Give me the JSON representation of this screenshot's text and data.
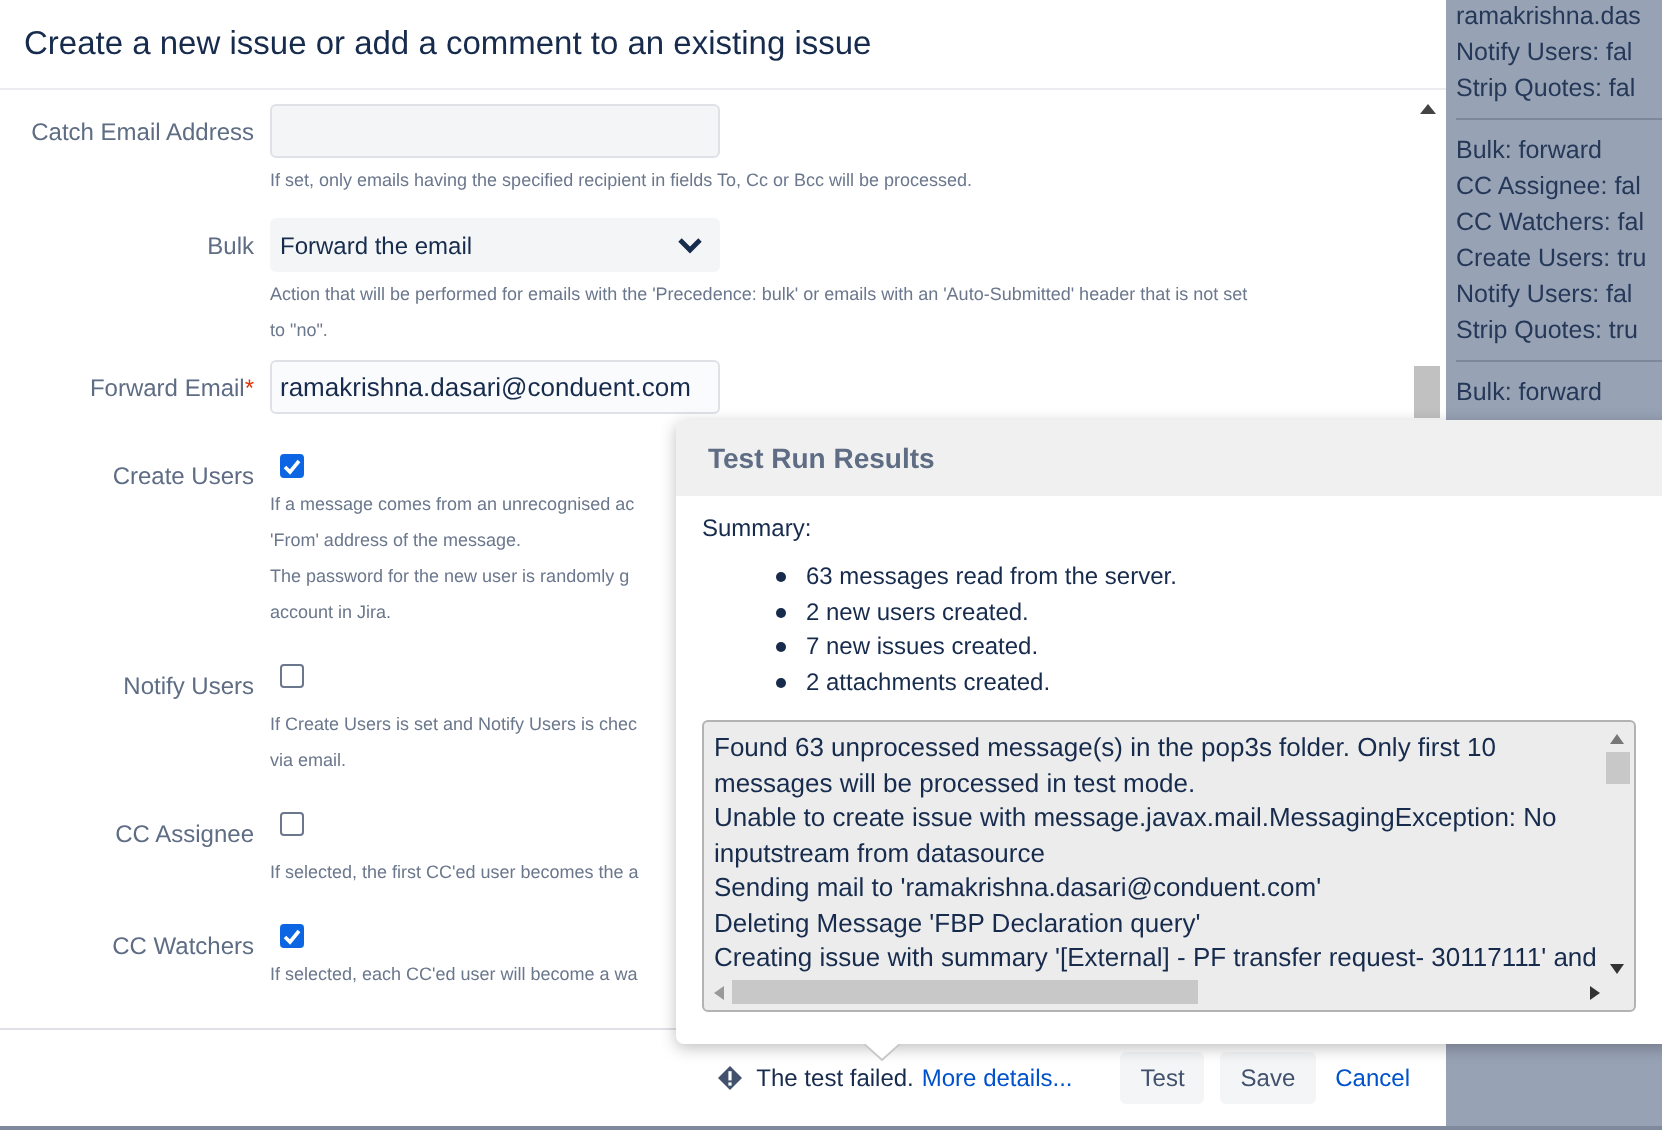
{
  "dialog": {
    "title": "Create a new issue or add a comment to an existing issue",
    "fields": [
      {
        "kind": "text",
        "label": "Catch Email Address",
        "help": [
          "If set, only emails having the specified recipient in fields To, Cc or Bcc will be processed."
        ]
      },
      {
        "kind": "select",
        "label": "Bulk",
        "value": "Forward the email",
        "help": [
          "Action that will be performed for emails with the 'Precedence: bulk' or emails with an 'Auto-Submitted' header that is not set",
          "to \"no\"."
        ]
      },
      {
        "kind": "text",
        "label": "Forward Email",
        "required_mark": "*",
        "value": "ramakrishna.dasari@conduent.com"
      },
      {
        "kind": "checkbox",
        "label": "Create Users",
        "checked": true,
        "help": [
          "If a message comes from an unrecognised ac",
          "'From' address of the message.",
          "The password for the new user is randomly g",
          "account in Jira."
        ]
      },
      {
        "kind": "checkbox",
        "label": "Notify Users",
        "checked": false,
        "help": [
          "If Create Users is set and Notify Users is chec",
          "via email."
        ]
      },
      {
        "kind": "checkbox",
        "label": "CC Assignee",
        "checked": false,
        "help": [
          "If selected, the first CC'ed user becomes the a"
        ]
      },
      {
        "kind": "checkbox",
        "label": "CC Watchers",
        "checked": true,
        "help": [
          "If selected, each CC'ed user will become a wa"
        ]
      }
    ],
    "footer": {
      "status": "The test failed.",
      "details_link": "More details...",
      "buttons": [
        "Test",
        "Save"
      ],
      "cancel": "Cancel"
    }
  },
  "side_panel": {
    "groups": [
      [
        "ramakrishna.das",
        "Notify Users: fal",
        "Strip Quotes: fal"
      ],
      [
        "Bulk: forward",
        "CC Assignee: fal",
        "CC Watchers: fal",
        "Create Users: tru",
        "Notify Users: fal",
        "Strip Quotes: tru"
      ],
      [
        "Bulk: forward"
      ]
    ]
  },
  "results": {
    "title": "Test Run Results",
    "summary_label": "Summary:",
    "summary": [
      "63 messages read from the server.",
      "2 new users created.",
      "7 new issues created.",
      "2 attachments created."
    ],
    "log": [
      "Found 63 unprocessed message(s) in the pop3s folder. Only first 10 messages will be processed in test mode.",
      "Unable to create issue with message.javax.mail.MessagingException: No inputstream from datasource",
      "Sending mail to 'ramakrishna.dasari@conduent.com'",
      "Deleting Message 'FBP Declaration query'",
      "Creating issue with summary '[External] - PF transfer request- 30117111' and"
    ]
  }
}
